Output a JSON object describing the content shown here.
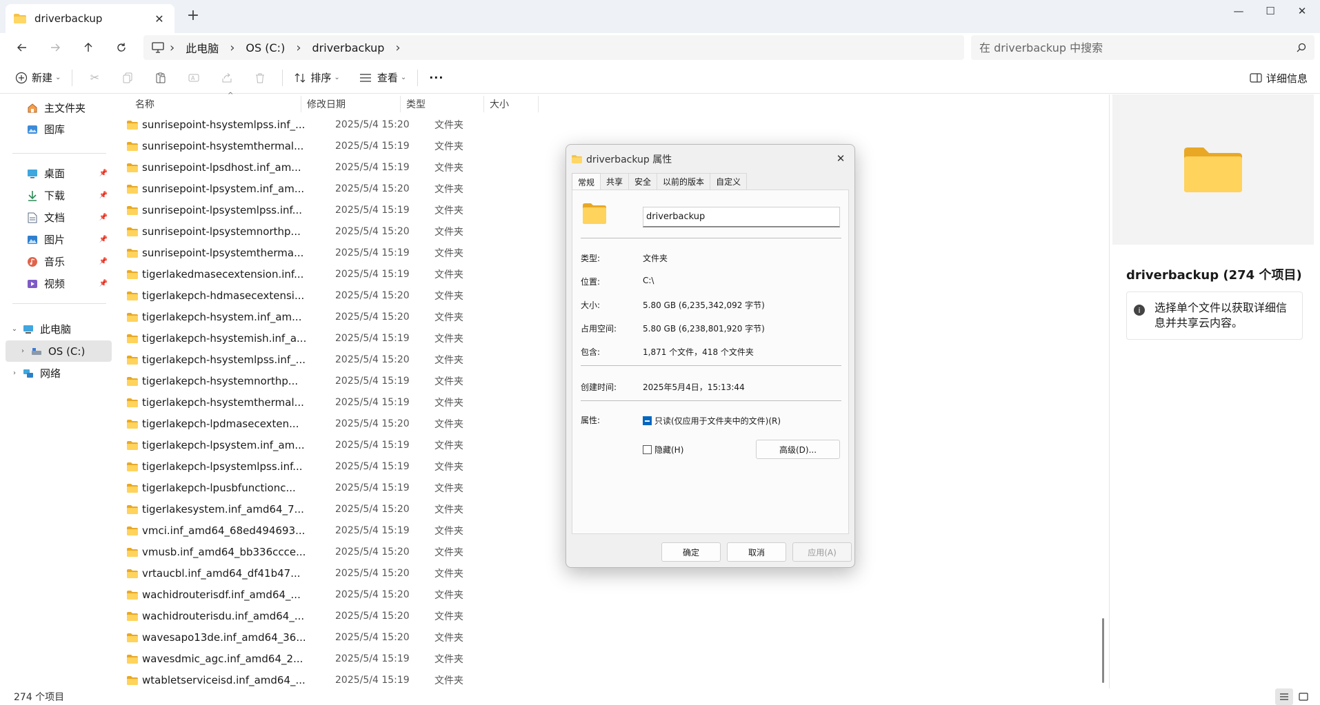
{
  "window": {
    "tab_title": "driverbackup",
    "tab_close": "✕",
    "new_tab": "+",
    "minimize": "—",
    "maximize": "☐",
    "close": "✕"
  },
  "address": {
    "crumbs": [
      "此电脑",
      "OS (C:)",
      "driverbackup"
    ],
    "search_placeholder": "在 driverbackup 中搜索"
  },
  "commandbar": {
    "new_label": "新建",
    "sort_label": "排序",
    "view_label": "查看",
    "more_label": "···",
    "details_label": "详细信息"
  },
  "sidebar": {
    "items": [
      {
        "label": "主文件夹",
        "icon": "home-icon"
      },
      {
        "label": "图库",
        "icon": "gallery-icon"
      },
      {
        "label": "桌面",
        "icon": "desktop-icon",
        "pinned": true
      },
      {
        "label": "下载",
        "icon": "download-icon",
        "pinned": true
      },
      {
        "label": "文档",
        "icon": "document-icon",
        "pinned": true
      },
      {
        "label": "图片",
        "icon": "pictures-icon",
        "pinned": true
      },
      {
        "label": "音乐",
        "icon": "music-icon",
        "pinned": true
      },
      {
        "label": "视频",
        "icon": "video-icon",
        "pinned": true
      },
      {
        "label": "此电脑",
        "icon": "computer-icon",
        "expanded": true
      },
      {
        "label": "OS (C:)",
        "icon": "drive-icon",
        "selected": true
      },
      {
        "label": "网络",
        "icon": "network-icon"
      }
    ]
  },
  "filelist": {
    "columns": [
      "名称",
      "修改日期",
      "类型",
      "大小"
    ],
    "rows": [
      {
        "name": "sunrisepoint-hsystemlpss.inf_...",
        "date": "2025/5/4 15:20",
        "type": "文件夹"
      },
      {
        "name": "sunrisepoint-hsystemthermal...",
        "date": "2025/5/4 15:19",
        "type": "文件夹"
      },
      {
        "name": "sunrisepoint-lpsdhost.inf_am...",
        "date": "2025/5/4 15:19",
        "type": "文件夹"
      },
      {
        "name": "sunrisepoint-lpsystem.inf_am...",
        "date": "2025/5/4 15:20",
        "type": "文件夹"
      },
      {
        "name": "sunrisepoint-lpsystemlpss.inf...",
        "date": "2025/5/4 15:19",
        "type": "文件夹"
      },
      {
        "name": "sunrisepoint-lpsystemnorthp...",
        "date": "2025/5/4 15:20",
        "type": "文件夹"
      },
      {
        "name": "sunrisepoint-lpsystemtherma...",
        "date": "2025/5/4 15:19",
        "type": "文件夹"
      },
      {
        "name": "tigerlakedmasecextension.inf...",
        "date": "2025/5/4 15:19",
        "type": "文件夹"
      },
      {
        "name": "tigerlakepch-hdmasecextensi...",
        "date": "2025/5/4 15:20",
        "type": "文件夹"
      },
      {
        "name": "tigerlakepch-hsystem.inf_am...",
        "date": "2025/5/4 15:20",
        "type": "文件夹"
      },
      {
        "name": "tigerlakepch-hsystemish.inf_a...",
        "date": "2025/5/4 15:19",
        "type": "文件夹"
      },
      {
        "name": "tigerlakepch-hsystemlpss.inf_...",
        "date": "2025/5/4 15:20",
        "type": "文件夹"
      },
      {
        "name": "tigerlakepch-hsystemnorthp...",
        "date": "2025/5/4 15:19",
        "type": "文件夹"
      },
      {
        "name": "tigerlakepch-hsystemthermal...",
        "date": "2025/5/4 15:19",
        "type": "文件夹"
      },
      {
        "name": "tigerlakepch-lpdmasecexten...",
        "date": "2025/5/4 15:20",
        "type": "文件夹"
      },
      {
        "name": "tigerlakepch-lpsystem.inf_am...",
        "date": "2025/5/4 15:19",
        "type": "文件夹"
      },
      {
        "name": "tigerlakepch-lpsystemlpss.inf...",
        "date": "2025/5/4 15:19",
        "type": "文件夹"
      },
      {
        "name": "tigerlakepch-lpusbfunctionc...",
        "date": "2025/5/4 15:19",
        "type": "文件夹"
      },
      {
        "name": "tigerlakesystem.inf_amd64_7...",
        "date": "2025/5/4 15:20",
        "type": "文件夹"
      },
      {
        "name": "vmci.inf_amd64_68ed494693...",
        "date": "2025/5/4 15:19",
        "type": "文件夹"
      },
      {
        "name": "vmusb.inf_amd64_bb336ccce...",
        "date": "2025/5/4 15:20",
        "type": "文件夹"
      },
      {
        "name": "vrtaucbl.inf_amd64_df41b47...",
        "date": "2025/5/4 15:20",
        "type": "文件夹"
      },
      {
        "name": "wachidrouterisdf.inf_amd64_...",
        "date": "2025/5/4 15:20",
        "type": "文件夹"
      },
      {
        "name": "wachidrouterisdu.inf_amd64_...",
        "date": "2025/5/4 15:20",
        "type": "文件夹"
      },
      {
        "name": "wavesapo13de.inf_amd64_36...",
        "date": "2025/5/4 15:20",
        "type": "文件夹"
      },
      {
        "name": "wavesdmic_agc.inf_amd64_2...",
        "date": "2025/5/4 15:19",
        "type": "文件夹"
      },
      {
        "name": "wtabletserviceisd.inf_amd64_...",
        "date": "2025/5/4 15:19",
        "type": "文件夹"
      }
    ]
  },
  "details": {
    "title": "driverbackup (274 个项目)",
    "info": "选择单个文件以获取详细信息并共享云内容。"
  },
  "status": {
    "count": "274 个项目"
  },
  "dialog": {
    "title": "driverbackup 属性",
    "close": "✕",
    "tabs": [
      "常规",
      "共享",
      "安全",
      "以前的版本",
      "自定义"
    ],
    "name_value": "driverbackup",
    "type_label": "类型:",
    "type_value": "文件夹",
    "location_label": "位置:",
    "location_value": "C:\\",
    "size_label": "大小:",
    "size_value": "5.80 GB (6,235,342,092 字节)",
    "disk_label": "占用空间:",
    "disk_value": "5.80 GB (6,238,801,920 字节)",
    "contains_label": "包含:",
    "contains_value": "1,871 个文件，418 个文件夹",
    "created_label": "创建时间:",
    "created_value": "2025年5月4日，15:13:44",
    "attr_label": "属性:",
    "readonly_label": "只读(仅应用于文件夹中的文件)(R)",
    "hidden_label": "隐藏(H)",
    "advanced_label": "高级(D)...",
    "ok_label": "确定",
    "cancel_label": "取消",
    "apply_label": "应用(A)"
  },
  "colors": {
    "folder": "#f4c24a",
    "accent": "#0067c0"
  }
}
